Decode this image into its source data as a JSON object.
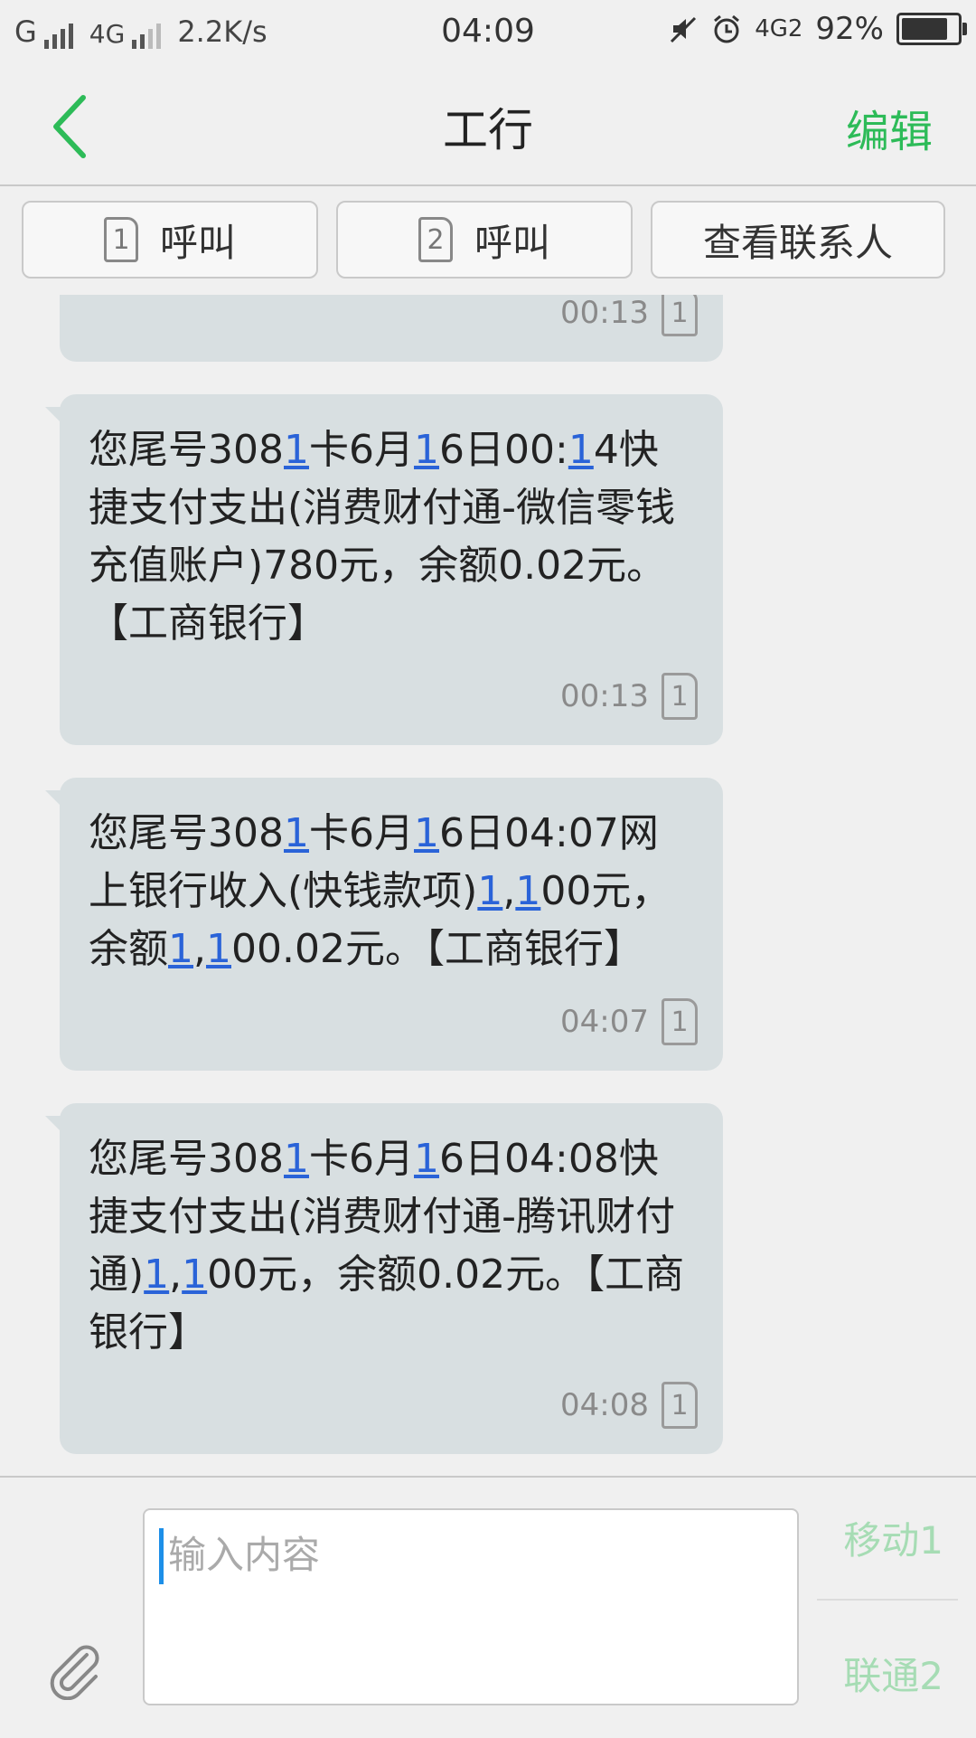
{
  "status_bar": {
    "carrier1": "G",
    "carrier2": "4G",
    "speed": "2.2K/s",
    "time": "04:09",
    "network": "4G2",
    "battery": "92%",
    "battery_level": 0.92
  },
  "header": {
    "title": "工行",
    "edit_label": "编辑"
  },
  "actions": {
    "call1": {
      "sim": "1",
      "label": "呼叫"
    },
    "call2": {
      "sim": "2",
      "label": "呼叫"
    },
    "contact_label": "查看联系人"
  },
  "messages": [
    {
      "text": "",
      "time": "00:13",
      "sim": "1"
    },
    {
      "text": "您尾号3081卡6月16日00:14快捷支付支出(消费财付通-微信零钱充值账户)780元，余额0.02元。【工商银行】",
      "time": "00:13",
      "sim": "1"
    },
    {
      "text": "您尾号3081卡6月16日04:07网上银行收入(快钱款项)1,100元，余额1,100.02元。【工商银行】",
      "time": "04:07",
      "sim": "1"
    },
    {
      "text": "您尾号3081卡6月16日04:08快捷支付支出(消费财付通-腾讯财付通)1,100元，余额0.02元。【工商银行】",
      "time": "04:08",
      "sim": "1"
    }
  ],
  "composer": {
    "placeholder": "输入内容",
    "send1": "移动1",
    "send2": "联通2"
  },
  "colors": {
    "accent": "#2dbb58",
    "bubble": "#d8dfe1",
    "link": "#2a63d8"
  }
}
